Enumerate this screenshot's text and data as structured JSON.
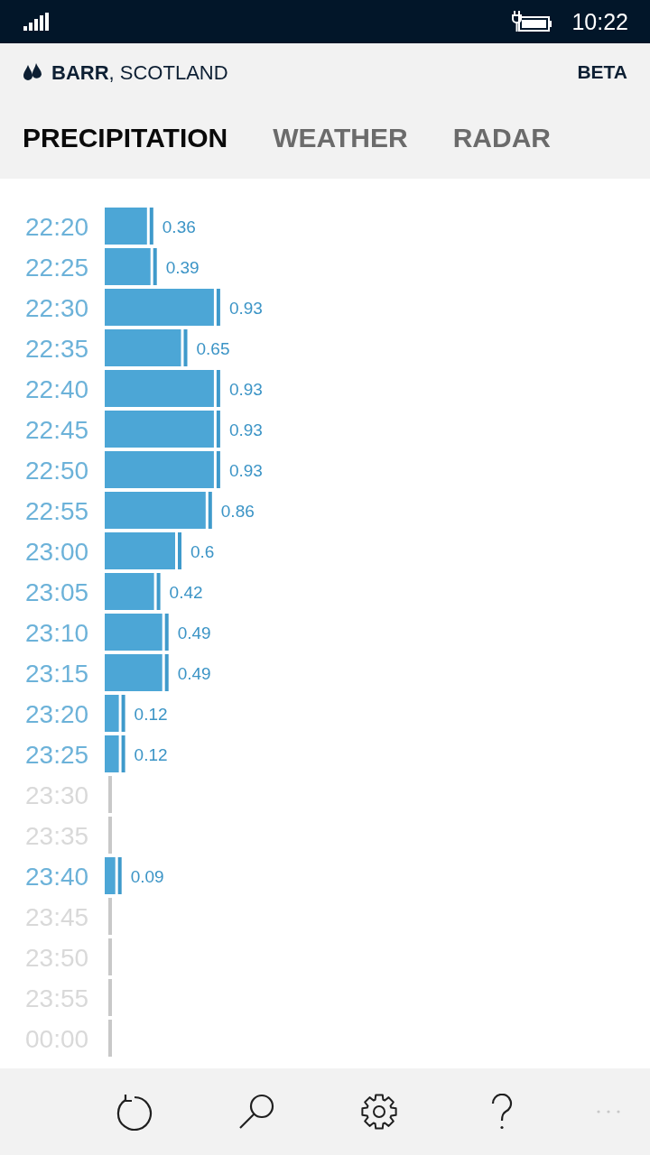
{
  "status_bar": {
    "time": "10:22"
  },
  "header": {
    "location": "**BARR**, SCOTLAND",
    "badge": "BETA"
  },
  "tabs": [
    {
      "label": "PRECIPITATION",
      "selected": true
    },
    {
      "label": "WEATHER",
      "selected": false
    },
    {
      "label": "RADAR",
      "selected": false
    }
  ],
  "precipitation": {
    "chart_data": {
      "type": "bar",
      "orientation": "horizontal",
      "categories": [
        "22:20",
        "22:25",
        "22:30",
        "22:35",
        "22:40",
        "22:45",
        "22:50",
        "22:55",
        "23:00",
        "23:05",
        "23:10",
        "23:15",
        "23:20",
        "23:25",
        "23:30",
        "23:35",
        "23:40",
        "23:45",
        "23:50",
        "23:55",
        "00:00"
      ],
      "values": [
        0.36,
        0.39,
        0.93,
        0.65,
        0.93,
        0.93,
        0.93,
        0.86,
        0.6,
        0.42,
        0.49,
        0.49,
        0.12,
        0.12,
        null,
        null,
        0.09,
        null,
        null,
        null,
        null
      ],
      "data_labels": true
    }
  }
}
